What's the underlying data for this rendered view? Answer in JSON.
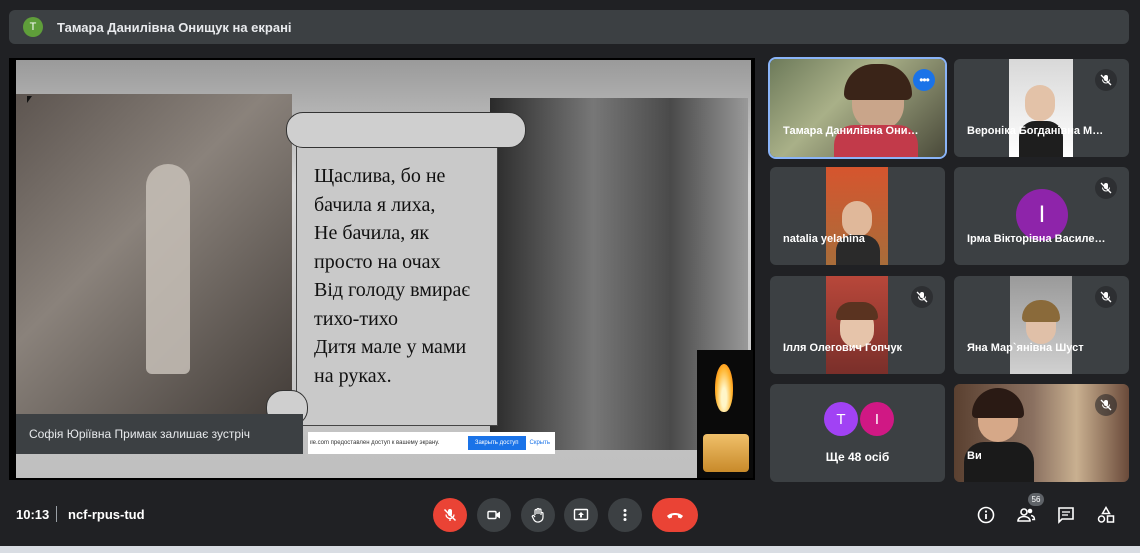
{
  "presenting_banner": {
    "avatar_letter": "Т",
    "text": "Тамара Данилівна Онищук на екрані"
  },
  "slide": {
    "poem_lines": [
      "Щаслива, бо не",
      "бачила я лиха,",
      "Не бачила, як",
      "просто на очах",
      "Від голоду вмирає",
      "тихо-тихо",
      "Дитя мале у мами",
      "на руках."
    ]
  },
  "toast": {
    "text": "Софія Юріївна Примак залишає зустріч"
  },
  "share_bar": {
    "message": "ile.com предоставлен доступ к вашему экрану.",
    "stop_button": "Закрыть доступ",
    "hide_button": "Скрыть"
  },
  "participants": [
    {
      "name": "Тамара Данилівна Они…",
      "muted": false
    },
    {
      "name": "Вероніка Богданівна М…",
      "muted": true
    },
    {
      "name": "natalia yelahina",
      "muted": false
    },
    {
      "name": "Ірма Вікторівна Василе…",
      "muted": true,
      "avatar_letter": "І"
    },
    {
      "name": "Ілля Олегович Гопчук",
      "muted": true
    },
    {
      "name": "Яна Мар`янівна Шуст",
      "muted": true
    },
    {
      "name": "Ви",
      "muted": true
    }
  ],
  "more_tile": {
    "avatars": [
      "Т",
      "І"
    ],
    "label": "Ще 48 осіб"
  },
  "bottom_bar": {
    "time": "10:13",
    "meeting_code": "ncf-rpus-tud",
    "participant_count": "56"
  },
  "colors": {
    "accent": "#1a73e8",
    "danger": "#ea4335",
    "background": "#202124",
    "tile": "#3c4043"
  }
}
